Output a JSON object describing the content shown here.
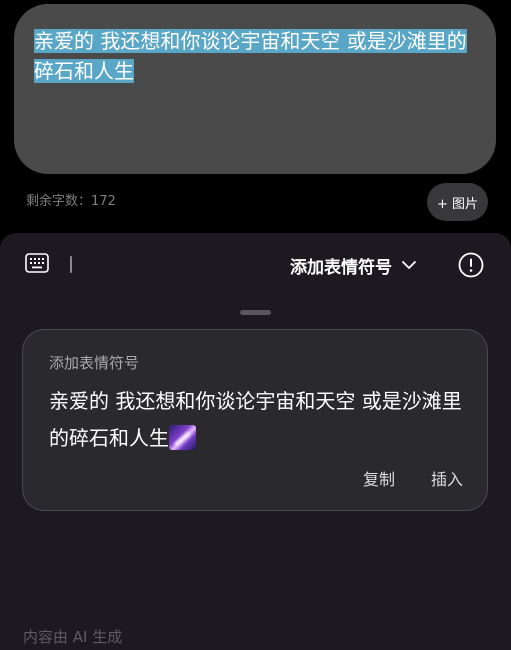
{
  "editor": {
    "text": "亲爱的 我还想和你谈论宇宙和天空 或是沙滩里的碎石和人生",
    "remaining_label": "剩余字数：172",
    "add_image_label": "+ 图片"
  },
  "toolbar": {
    "keyboard_icon": "keyboard-icon",
    "menu_label": "添加表情符号",
    "chevron_icon": "chevron-down-icon",
    "info_icon": "info-circle-icon"
  },
  "result_card": {
    "title": "添加表情符号",
    "body": "亲爱的 我还想和你谈论宇宙和天空 或是沙滩里的碎石和人生",
    "emoji": "milky-way-emoji",
    "copy_label": "复制",
    "insert_label": "插入"
  },
  "footer": {
    "ai_note": "内容由 AI 生成"
  },
  "colors": {
    "selection": "#5aa6c7",
    "editor_bg": "#4a4a4b",
    "panel_bg": "#1c1a20",
    "card_bg": "#2a292d"
  }
}
